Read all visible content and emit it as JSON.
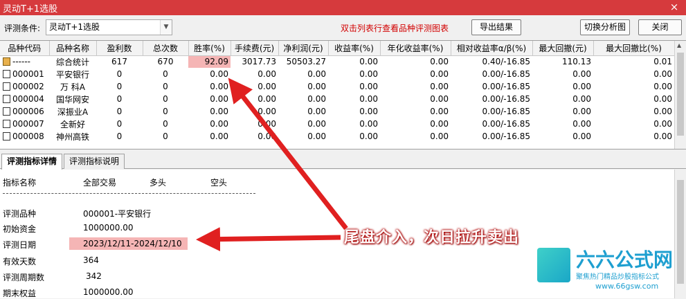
{
  "window": {
    "title": "灵动T+1选股",
    "close_glyph": "×"
  },
  "toolbar": {
    "condition_label": "评测条件:",
    "condition_value": "灵动T+1选股",
    "hint": "双击列表行查看品种评测图表",
    "export_button": "导出结果",
    "switch_button": "切换分析图",
    "close_button": "关闭"
  },
  "grid": {
    "columns": [
      "品种代码",
      "品种名称",
      "盈利数",
      "总次数",
      "胜率(%)",
      "手续费(元)",
      "净利润(元)",
      "收益率(%)",
      "年化收益率(%)",
      "相对收益率α/β(%)",
      "最大回撤(元)",
      "最大回撤比(%)"
    ],
    "rows": [
      [
        "------",
        "综合统计",
        "617",
        "670",
        "92.09",
        "3017.73",
        "50503.27",
        "0.00",
        "0.00",
        "0.40/-16.85",
        "110.13",
        "0.01"
      ],
      [
        "000001",
        "平安银行",
        "0",
        "0",
        "0.00",
        "0.00",
        "0.00",
        "0.00",
        "0.00",
        "0.00/-16.85",
        "0.00",
        "0.00"
      ],
      [
        "000002",
        "万 科A",
        "0",
        "0",
        "0.00",
        "0.00",
        "0.00",
        "0.00",
        "0.00",
        "0.00/-16.85",
        "0.00",
        "0.00"
      ],
      [
        "000004",
        "国华网安",
        "0",
        "0",
        "0.00",
        "0.00",
        "0.00",
        "0.00",
        "0.00",
        "0.00/-16.85",
        "0.00",
        "0.00"
      ],
      [
        "000006",
        "深振业A",
        "0",
        "0",
        "0.00",
        "0.00",
        "0.00",
        "0.00",
        "0.00",
        "0.00/-16.85",
        "0.00",
        "0.00"
      ],
      [
        "000007",
        "全新好",
        "0",
        "0",
        "0.00",
        "0.00",
        "0.00",
        "0.00",
        "0.00",
        "0.00/-16.85",
        "0.00",
        "0.00"
      ],
      [
        "000008",
        "神州高铁",
        "0",
        "0",
        "0.00",
        "0.00",
        "0.00",
        "0.00",
        "0.00",
        "0.00/-16.85",
        "0.00",
        "0.00"
      ]
    ]
  },
  "tabs": [
    "评测指标详情",
    "评测指标说明"
  ],
  "detail": {
    "header": [
      "指标名称",
      "全部交易",
      "多头",
      "空头"
    ],
    "items": [
      {
        "label": "评测品种",
        "value": "000001-平安银行"
      },
      {
        "label": "初始资金",
        "value": "1000000.00"
      },
      {
        "label": "评测日期",
        "value": "2023/12/11-2024/12/10"
      },
      {
        "label": "有效天数",
        "value": "364"
      },
      {
        "label": "评测周期数",
        "value": "342"
      },
      {
        "label": "期末权益",
        "value": "1000000.00"
      }
    ]
  },
  "annotation": "尾盘介入，次日拉升卖出",
  "watermark": {
    "name": "六六公式网",
    "slogan": "聚焦热门精品炒股指标公式",
    "url": "www.66gsw.com"
  },
  "colors": {
    "titlebar": "#d63a3d",
    "highlight": "#f5b5b5",
    "arrow": "#e02020",
    "hint": "#d20000",
    "watermark": "#1e9fd0"
  }
}
